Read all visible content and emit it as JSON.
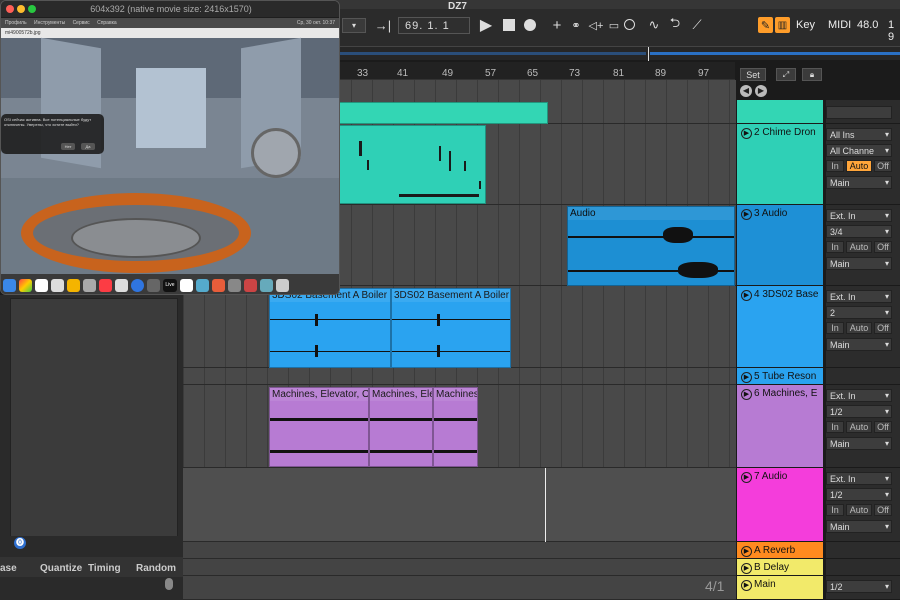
{
  "daw": {
    "title": "DZ7",
    "transport": {
      "position": "69.  1.  1",
      "key_label": "Key",
      "midi_label": "MIDI",
      "cpu": "48.0",
      "right_partial": "1 9"
    },
    "ruler": [
      "33",
      "41",
      "49",
      "57",
      "65",
      "73",
      "81",
      "89",
      "97"
    ],
    "set_label": "Set",
    "page_indicator": "4/1"
  },
  "tracks": [
    {
      "name": "2 Chime Dron",
      "color": "#2fd0b6",
      "input": "All Ins",
      "channel": "All Channe",
      "monitor": [
        "In",
        "Auto",
        "Off"
      ],
      "monitor_active": "Auto",
      "output": "Main"
    },
    {
      "name": "3 Audio",
      "color": "#1e90d6",
      "input": "Ext. In",
      "channel": "3/4",
      "monitor": [
        "In",
        "Auto",
        "Off"
      ],
      "output": "Main"
    },
    {
      "name": "4 3DS02 Base",
      "color": "#2aa3f0",
      "input": "Ext. In",
      "channel": "2",
      "monitor": [
        "In",
        "Auto",
        "Off"
      ],
      "output": "Main"
    },
    {
      "name": "5 Tube Reson",
      "color": "#2aa3f0"
    },
    {
      "name": "6 Machines, E",
      "color": "#b77bd3",
      "input": "Ext. In",
      "channel": "1/2",
      "monitor": [
        "In",
        "Auto",
        "Off"
      ],
      "output": "Main"
    },
    {
      "name": "7 Audio",
      "color": "#f43ddb",
      "input": "Ext. In",
      "channel": "1/2",
      "monitor": [
        "In",
        "Auto",
        "Off"
      ],
      "output": "Main"
    },
    {
      "name": "A Reverb",
      "color": "#ff8a1f"
    },
    {
      "name": "B Delay",
      "color": "#f2ea6a"
    },
    {
      "name": "Main",
      "color": "#f2ea6a",
      "output": "1/2"
    }
  ],
  "clips": {
    "audio": "Audio",
    "basement_1": "3DS02 Basement A Boiler R",
    "basement_2": "3DS02 Basement A Boiler R",
    "machines_1": "Machines, Elevator, O",
    "machines_2": "Machines, Ele",
    "machines_3": "Machines"
  },
  "left_panel": {
    "headers": [
      "ase",
      "Quantize",
      "Timing",
      "Random"
    ]
  },
  "mac_window": {
    "title": "604x392 (native movie size: 2416x1570)",
    "menu": [
      "Профиль",
      "Инструменты",
      "Сервис",
      "Справка"
    ],
    "clock": "Ср, 30 окт. 10:37",
    "filename": "mi4900572b.jpg",
    "dialog_text": "OSI сейчас активна. Все потенциальные будут отключены. Уверены, что хотите выйти?",
    "dialog_btn1": "Нет",
    "dialog_btn2": "Да",
    "dock_live": "Live"
  }
}
